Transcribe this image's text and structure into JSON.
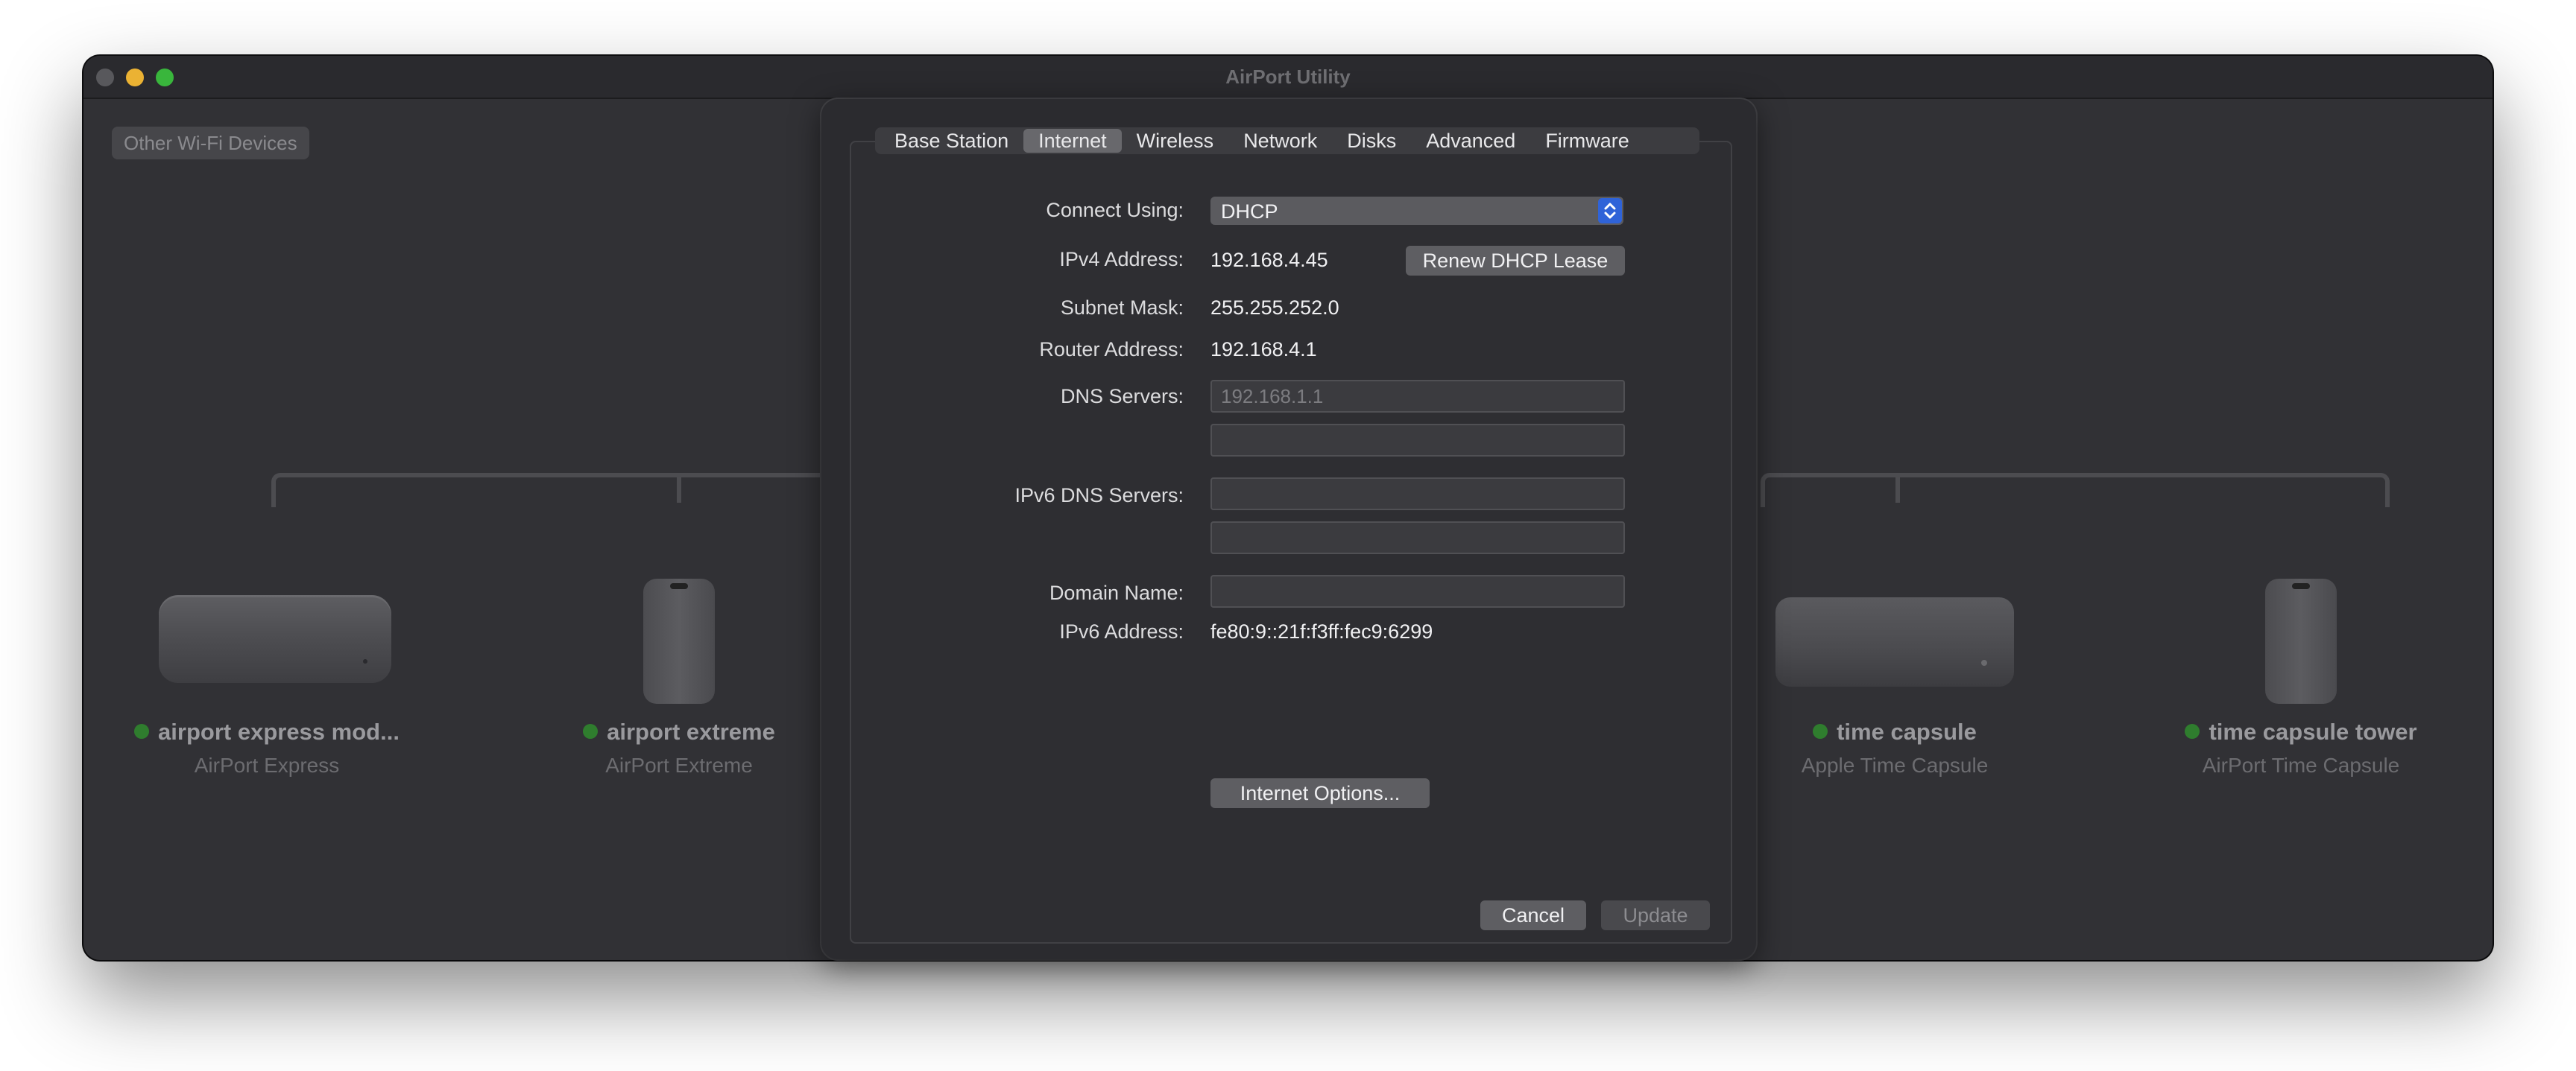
{
  "window": {
    "title": "AirPort Utility"
  },
  "sidebar_button": {
    "label": "Other Wi-Fi Devices"
  },
  "devices": [
    {
      "name": "airport express mod...",
      "type": "AirPort Express",
      "status_color": "#2f7d2e"
    },
    {
      "name": "airport extreme",
      "type": "AirPort Extreme",
      "status_color": "#2f7d2e"
    },
    {
      "name": "time capsule",
      "type": "Apple Time Capsule",
      "status_color": "#2f7d2e"
    },
    {
      "name": "time capsule tower",
      "type": "AirPort Time Capsule",
      "status_color": "#2f7d2e"
    }
  ],
  "sheet": {
    "tabs": [
      {
        "label": "Base Station",
        "selected": false
      },
      {
        "label": "Internet",
        "selected": true
      },
      {
        "label": "Wireless",
        "selected": false
      },
      {
        "label": "Network",
        "selected": false
      },
      {
        "label": "Disks",
        "selected": false
      },
      {
        "label": "Advanced",
        "selected": false
      },
      {
        "label": "Firmware",
        "selected": false
      }
    ],
    "connect_using": {
      "label": "Connect Using:",
      "value": "DHCP"
    },
    "ipv4": {
      "label": "IPv4 Address:",
      "value": "192.168.4.45"
    },
    "renew_button": "Renew DHCP Lease",
    "subnet": {
      "label": "Subnet Mask:",
      "value": "255.255.252.0"
    },
    "router": {
      "label": "Router Address:",
      "value": "192.168.4.1"
    },
    "dns": {
      "label": "DNS Servers:",
      "placeholder1": "192.168.1.1",
      "value1": "",
      "value2": ""
    },
    "ipv6_dns": {
      "label": "IPv6 DNS Servers:",
      "value1": "",
      "value2": ""
    },
    "domain": {
      "label": "Domain Name:",
      "value": ""
    },
    "ipv6": {
      "label": "IPv6 Address:",
      "value": "fe80:9::21f:f3ff:fec9:6299"
    },
    "internet_options_button": "Internet Options...",
    "cancel_button": "Cancel",
    "update_button": "Update"
  },
  "colors": {
    "accent": "#2f63d8",
    "status_online": "#2f7d2e"
  }
}
